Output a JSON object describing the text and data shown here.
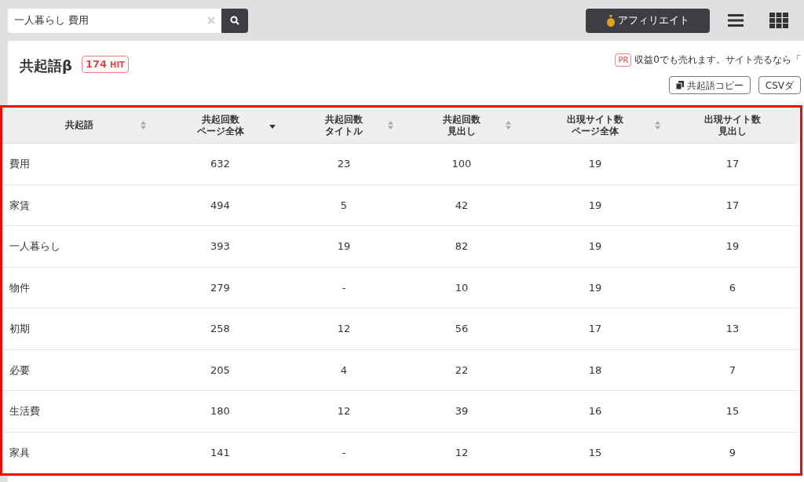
{
  "search": {
    "value": "一人暮らし 費用"
  },
  "header": {
    "affiliate_button": "アフィリエイト"
  },
  "panel": {
    "title": "共起語β",
    "hit_count": "174",
    "hit_unit": "HIT",
    "pr_badge": "PR",
    "pr_text": "収益0でも売れます。サイト売るなら「",
    "buttons": [
      "共起語コピー",
      "CSVダ"
    ]
  },
  "table": {
    "columns": [
      {
        "lines": [
          "共起語"
        ],
        "sortable": true,
        "sorted_descending": false
      },
      {
        "lines": [
          "共起回数",
          "ページ全体"
        ],
        "sortable": true,
        "sorted_descending": true
      },
      {
        "lines": [
          "共起回数",
          "タイトル"
        ],
        "sortable": true,
        "sorted_descending": false
      },
      {
        "lines": [
          "共起回数",
          "見出し"
        ],
        "sortable": true,
        "sorted_descending": false
      },
      {
        "lines": [
          "出現サイト数",
          "ページ全体"
        ],
        "sortable": true,
        "sorted_descending": false
      },
      {
        "lines": [
          "出現サイト数",
          "見出し"
        ],
        "sortable": false
      }
    ],
    "rows": [
      [
        "費用",
        "632",
        "23",
        "100",
        "19",
        "17"
      ],
      [
        "家賃",
        "494",
        "5",
        "42",
        "19",
        "17"
      ],
      [
        "一人暮らし",
        "393",
        "19",
        "82",
        "19",
        "19"
      ],
      [
        "物件",
        "279",
        "-",
        "10",
        "19",
        "6"
      ],
      [
        "初期",
        "258",
        "12",
        "56",
        "17",
        "13"
      ],
      [
        "必要",
        "205",
        "4",
        "22",
        "18",
        "7"
      ],
      [
        "生活費",
        "180",
        "12",
        "39",
        "16",
        "15"
      ],
      [
        "家具",
        "141",
        "-",
        "12",
        "15",
        "9"
      ]
    ]
  }
}
